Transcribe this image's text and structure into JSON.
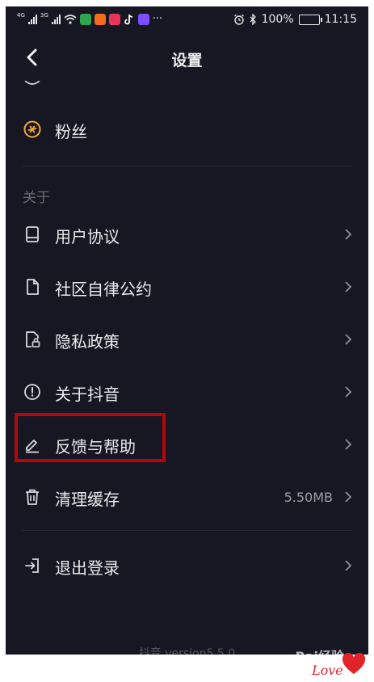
{
  "status_bar": {
    "net_left": "4G",
    "net_right": "3G",
    "more": "···",
    "battery": "100%",
    "time": "11:15",
    "app_colors": [
      "#2ea44f",
      "#f26b1d",
      "#e7345a",
      "#ffffff",
      "#7b4dff"
    ]
  },
  "header": {
    "title": "设置"
  },
  "items": {
    "fans": {
      "label": "粉丝",
      "icon": "fans-icon",
      "accent": "#f2a93b"
    },
    "section_about": "关于",
    "user_agreement": {
      "label": "用户协议",
      "icon": "book-icon"
    },
    "community": {
      "label": "社区自律公约",
      "icon": "document-icon"
    },
    "privacy": {
      "label": "隐私政策",
      "icon": "lock-document-icon"
    },
    "about": {
      "label": "关于抖音",
      "icon": "info-icon"
    },
    "feedback": {
      "label": "反馈与帮助",
      "icon": "pencil-icon"
    },
    "clear_cache": {
      "label": "清理缓存",
      "icon": "trash-icon",
      "value": "5.50MB"
    },
    "logout": {
      "label": "退出登录",
      "icon": "logout-icon"
    }
  },
  "footer": {
    "version": "抖音 version5.5.0"
  },
  "watermark": {
    "text": "Bai经验",
    "love": "Love"
  }
}
